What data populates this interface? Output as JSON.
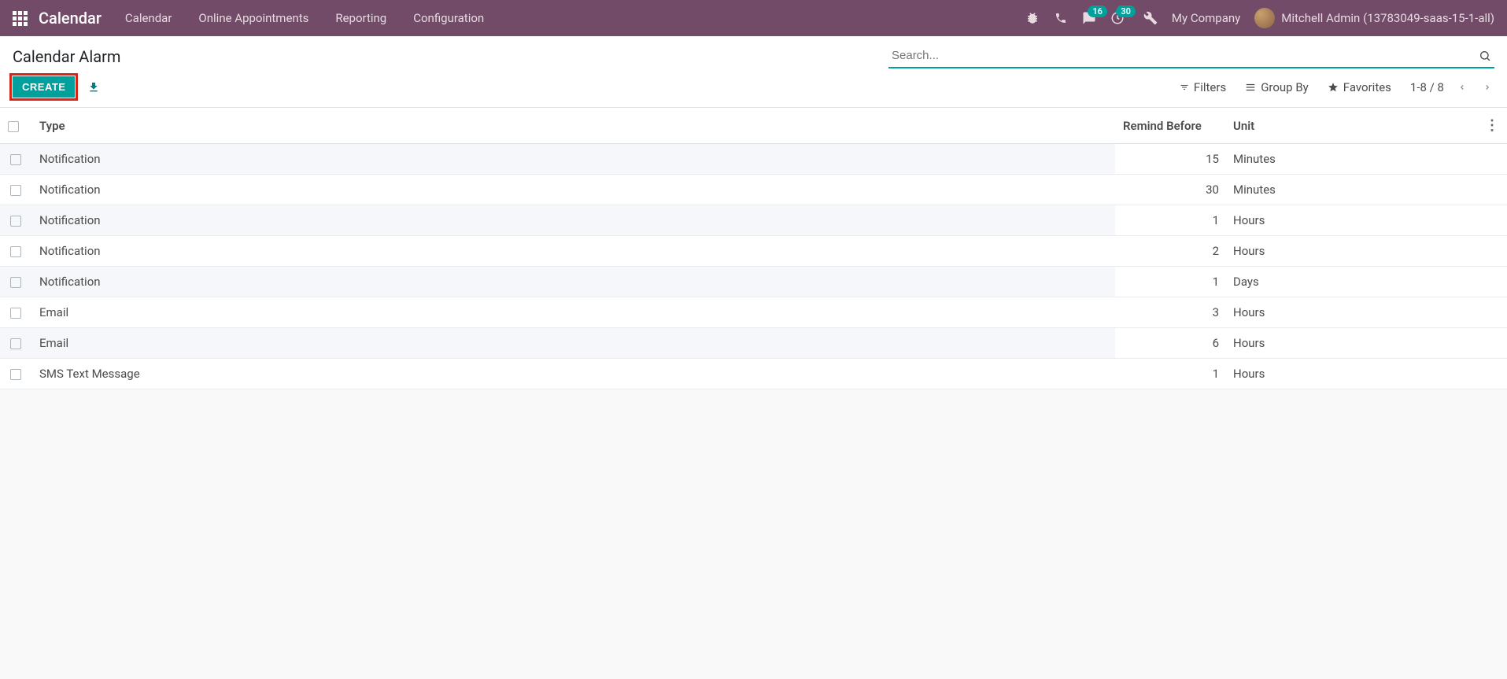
{
  "navbar": {
    "brand": "Calendar",
    "menu": [
      "Calendar",
      "Online Appointments",
      "Reporting",
      "Configuration"
    ],
    "message_badge": "16",
    "activity_badge": "30",
    "company": "My Company",
    "user": "Mitchell Admin (13783049-saas-15-1-all)"
  },
  "control": {
    "breadcrumb": "Calendar Alarm",
    "search_placeholder": "Search...",
    "create_label": "CREATE",
    "filters_label": "Filters",
    "groupby_label": "Group By",
    "favorites_label": "Favorites",
    "pager_text": "1-8 / 8"
  },
  "table": {
    "headers": {
      "type": "Type",
      "remind": "Remind Before",
      "unit": "Unit"
    },
    "rows": [
      {
        "type": "Notification",
        "remind": "15",
        "unit": "Minutes"
      },
      {
        "type": "Notification",
        "remind": "30",
        "unit": "Minutes"
      },
      {
        "type": "Notification",
        "remind": "1",
        "unit": "Hours"
      },
      {
        "type": "Notification",
        "remind": "2",
        "unit": "Hours"
      },
      {
        "type": "Notification",
        "remind": "1",
        "unit": "Days"
      },
      {
        "type": "Email",
        "remind": "3",
        "unit": "Hours"
      },
      {
        "type": "Email",
        "remind": "6",
        "unit": "Hours"
      },
      {
        "type": "SMS Text Message",
        "remind": "1",
        "unit": "Hours"
      }
    ]
  }
}
